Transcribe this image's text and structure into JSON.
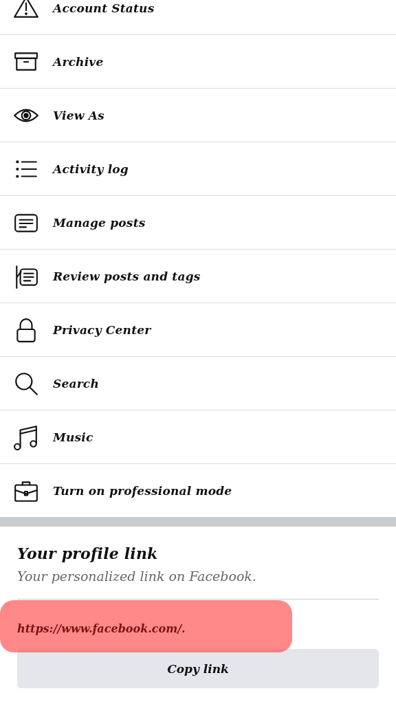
{
  "menu": [
    {
      "label": "Account Status"
    },
    {
      "label": "Archive"
    },
    {
      "label": "View As"
    },
    {
      "label": "Activity log"
    },
    {
      "label": "Manage posts"
    },
    {
      "label": "Review posts and tags"
    },
    {
      "label": "Privacy Center"
    },
    {
      "label": "Search"
    },
    {
      "label": "Music"
    },
    {
      "label": "Turn on professional mode"
    }
  ],
  "profile_link": {
    "title": "Your profile link",
    "subtitle": "Your personalized link on Facebook.",
    "url": "https://www.facebook.com/.",
    "highlighted": true,
    "button": "Copy link"
  }
}
